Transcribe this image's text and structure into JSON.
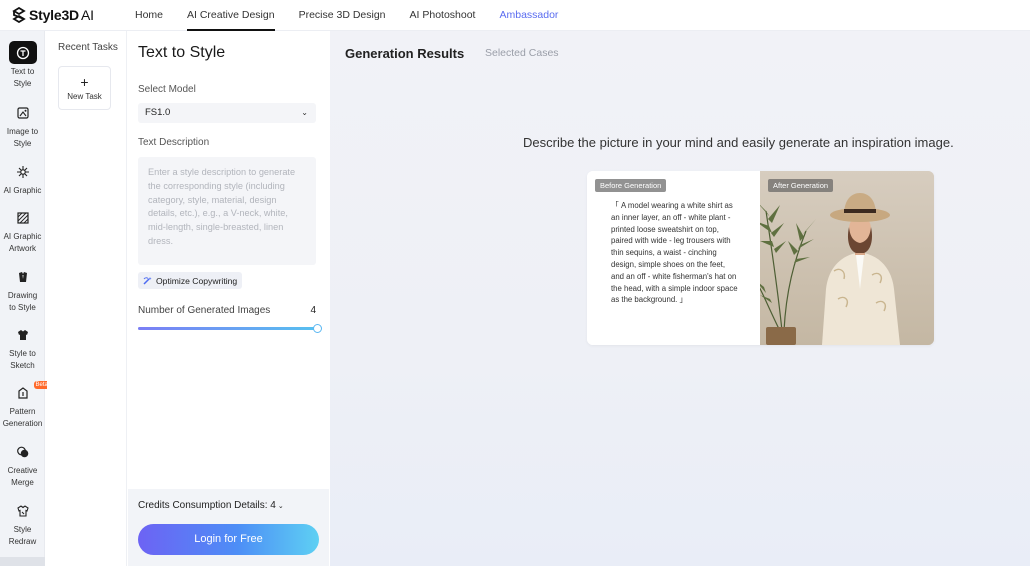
{
  "brand": {
    "name": "Style3D",
    "suffix": "AI"
  },
  "nav": {
    "items": [
      {
        "label": "Home",
        "active": false
      },
      {
        "label": "AI Creative Design",
        "active": true
      },
      {
        "label": "Precise 3D Design",
        "active": false
      },
      {
        "label": "AI Photoshoot",
        "active": false
      },
      {
        "label": "Ambassador",
        "active": false
      }
    ]
  },
  "rail": {
    "items": [
      {
        "label": "Text to Style",
        "icon": "text-to-style-icon",
        "active": true
      },
      {
        "label": "Image to Style",
        "icon": "image-to-style-icon"
      },
      {
        "label": "AI Graphic",
        "icon": "ai-graphic-icon"
      },
      {
        "label": "AI Graphic Artwork",
        "icon": "artwork-icon"
      },
      {
        "label": "Drawing to Style",
        "icon": "drawing-icon"
      },
      {
        "label": "Style to Sketch",
        "icon": "sketch-icon"
      },
      {
        "label": "Pattern Generation",
        "icon": "pattern-icon",
        "badge": "Beta"
      },
      {
        "label": "Creative Merge",
        "icon": "merge-icon"
      },
      {
        "label": "Style Redraw",
        "icon": "redraw-icon"
      }
    ]
  },
  "recent": {
    "title": "Recent Tasks",
    "new_task": "New Task"
  },
  "panel": {
    "title": "Text to Style",
    "model_label": "Select Model",
    "model_value": "FS1.0",
    "text_label": "Text Description",
    "text_placeholder": "Enter a style description to generate the corresponding style (including category, style, material, design details, etc.), e.g., a V-neck, white, mid-length, single-breasted, linen dress.",
    "optimize_label": "Optimize Copywriting",
    "count_label": "Number of Generated Images",
    "count_value": "4",
    "count_fraction": 1.0,
    "credits_label": "Credits Consumption Details: 4",
    "login_label": "Login for Free"
  },
  "main": {
    "tabs": [
      {
        "label": "Generation Results",
        "active": true
      },
      {
        "label": "Selected Cases",
        "active": false
      }
    ],
    "headline": "Describe the picture in your mind and easily generate an inspiration image.",
    "before_label": "Before Generation",
    "after_label": "After Generation",
    "example_text": "「 A model wearing a white shirt as an inner layer, an off - white plant - printed loose sweatshirt on top, paired with wide - leg trousers with thin sequins, a waist - cinching design, simple shoes on the feet, and an off - white fisherman's hat on the head, with a simple indoor space as the background. 」"
  }
}
